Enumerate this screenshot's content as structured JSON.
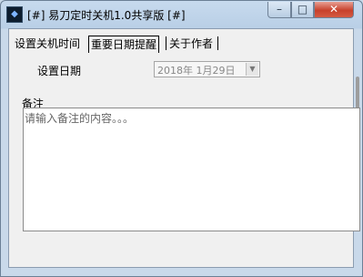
{
  "window": {
    "title": "[#] 易刀定时关机1.0共享版 [#]",
    "icon_name": "app-icon",
    "controls": {
      "minimize": "–",
      "maximize": "□",
      "close": "✕"
    }
  },
  "tabs": [
    {
      "label": "设置关机时间",
      "selected": false
    },
    {
      "label": "重要日期提醒",
      "selected": true
    },
    {
      "label": "关于作者",
      "selected": false
    }
  ],
  "reminder": {
    "date_label": "设置日期",
    "date_value": "2018年  1月29日",
    "notes_label": "备注",
    "notes_placeholder": "请输入备注的内容。。。"
  },
  "colors": {
    "titlebar": "#c7daee",
    "close_button": "#c7412c",
    "client_background": "#f0f0f0"
  }
}
